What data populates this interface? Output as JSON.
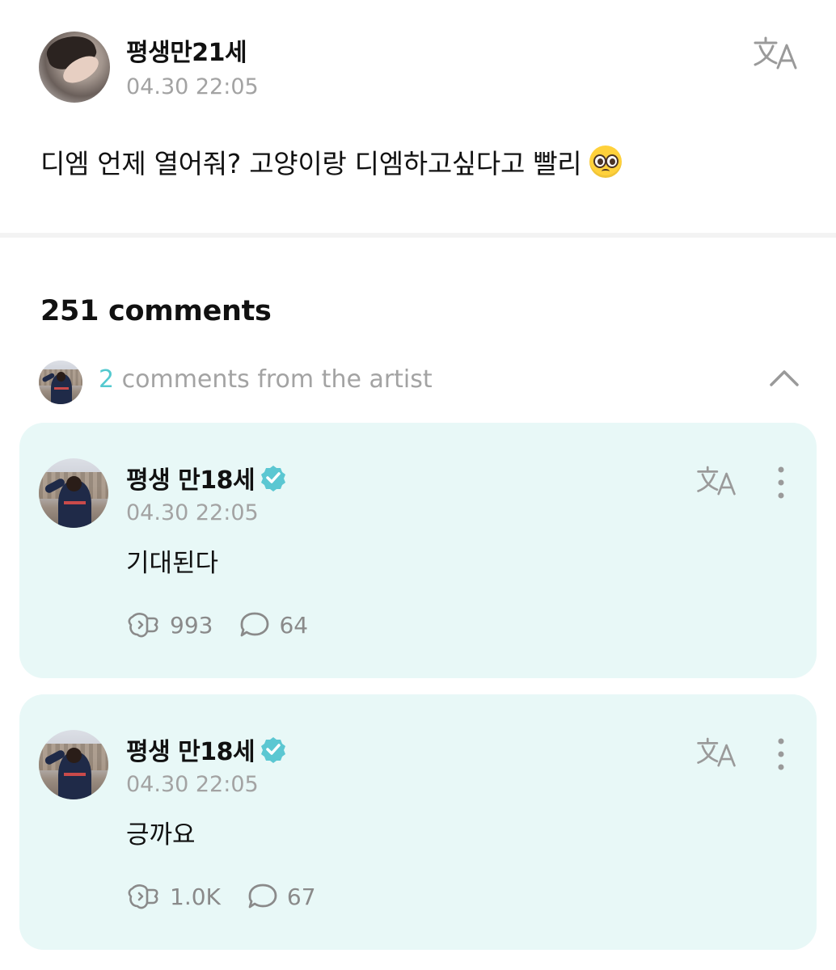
{
  "post": {
    "author": "평생만21세",
    "time": "04.30 22:05",
    "text": "디엠 언제 열어줘? 고양이랑 디엠하고싶다고 빨리",
    "emoji_icon": "pleading-face-emoji"
  },
  "comments_header": {
    "count_label": "251 comments",
    "artist_count": "2",
    "artist_label": " comments from the artist"
  },
  "artist_comments": [
    {
      "author": "평생 만18세",
      "time": "04.30 22:05",
      "text": "기대된다",
      "likes": "993",
      "replies": "64"
    },
    {
      "author": "평생 만18세",
      "time": "04.30 22:05",
      "text": "긍까요",
      "likes": "1.0K",
      "replies": "67"
    }
  ],
  "colors": {
    "accent": "#54c9cf",
    "card_bg": "#e8f8f7",
    "muted_text": "#a3a3a3",
    "verified": "#5bc7d2"
  },
  "icons": [
    "translate-icon",
    "verified-badge-icon",
    "more-options-icon",
    "like-icon",
    "reply-icon",
    "chevron-up-icon"
  ]
}
